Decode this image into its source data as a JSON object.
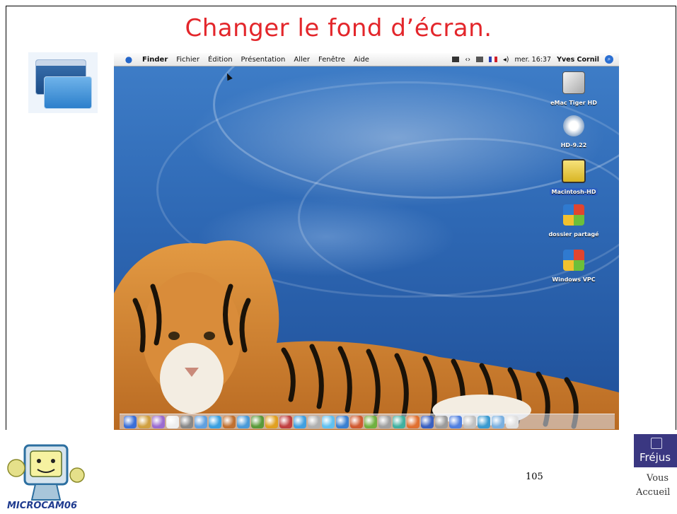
{
  "slide": {
    "title": "Changer le fond d’écran.",
    "page_number": "105"
  },
  "menubar": {
    "apple_icon": "apple-icon",
    "items": [
      "Finder",
      "Fichier",
      "Édition",
      "Présentation",
      "Aller",
      "Fenêtre",
      "Aide"
    ],
    "clock": "mer. 16:37",
    "user": "Yves Cornil",
    "spotlight_icon": "spotlight-icon"
  },
  "desktop_icons": [
    {
      "label": "eMac Tiger HD",
      "icon": "hard-drive-icon",
      "color": "#d9d9d9"
    },
    {
      "label": "HD-9.22",
      "icon": "network-drive-icon",
      "color": "#c9d6e4"
    },
    {
      "label": "Macintosh-HD",
      "icon": "hard-drive-icon",
      "color": "#f0d040",
      "selected": true
    },
    {
      "label": "dossier partagé",
      "icon": "windows-folder-icon",
      "color": "#5aa84a"
    },
    {
      "label": "Windows VPC",
      "icon": "windows-folder-icon",
      "color": "#5aa84a"
    }
  ],
  "dock": {
    "colors": [
      "#3a6fd8",
      "#d0a040",
      "#9a6bd0",
      "#eeeeee",
      "#888888",
      "#60a0e0",
      "#3aa0e0",
      "#c07030",
      "#4a9ad8",
      "#5a9a3a",
      "#e0a020",
      "#c04040",
      "#40a0e0",
      "#b0b0b0",
      "#60c0f0",
      "#3a80d0",
      "#d05a30",
      "#70b040",
      "#a0a0a0",
      "#40b0a0",
      "#e07030",
      "#3a60c0",
      "#9a9a9a",
      "#5080e0",
      "#c0c0c0",
      "#3a9ad0",
      "#7ab0e0",
      "#e0e0e0"
    ]
  },
  "logos": {
    "left_text": "MICROCAM06",
    "right_name": "Fréjus",
    "right_line1": "Vous",
    "right_line2": "Accueil"
  }
}
